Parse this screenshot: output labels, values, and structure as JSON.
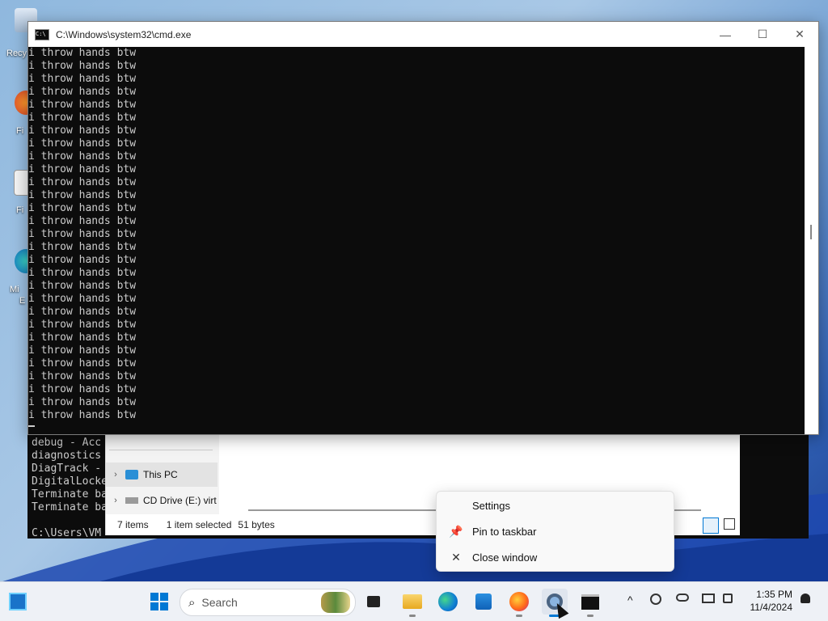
{
  "cmd_window": {
    "title": "C:\\Windows\\system32\\cmd.exe",
    "output_lines": [
      "i throw hands btw",
      "i throw hands btw",
      "i throw hands btw",
      "i throw hands btw",
      "i throw hands btw",
      "i throw hands btw",
      "i throw hands btw",
      "i throw hands btw",
      "i throw hands btw",
      "i throw hands btw",
      "i throw hands btw",
      "i throw hands btw",
      "i throw hands btw",
      "i throw hands btw",
      "i throw hands btw",
      "i throw hands btw",
      "i throw hands btw",
      "i throw hands btw",
      "i throw hands btw",
      "i throw hands btw",
      "i throw hands btw",
      "i throw hands btw",
      "i throw hands btw",
      "i throw hands btw",
      "i throw hands btw",
      "i throw hands btw",
      "i throw hands btw",
      "i throw hands btw",
      "i throw hands btw"
    ],
    "icon_label": "C:\\",
    "minimize_icon": "—",
    "maximize_icon": "☐",
    "close_icon": "✕"
  },
  "background_console": {
    "lines": [
      "debug - Acc",
      "diagnostics",
      "DiagTrack -",
      "DigitalLocke",
      "Terminate ba",
      "Terminate ba",
      "",
      "C:\\Users\\VM"
    ]
  },
  "explorer": {
    "nav": [
      {
        "label": "This PC",
        "icon": "computer-icon",
        "chevron": "›"
      },
      {
        "label": "CD Drive (E:) virt",
        "icon": "cd-drive-icon",
        "chevron": "›"
      }
    ],
    "status": {
      "items": "7 items",
      "selected": "1 item selected",
      "size": "51 bytes"
    }
  },
  "desktop_icons": [
    {
      "label": "Recy",
      "icon": "recycle-bin-icon"
    },
    {
      "label": "Fi",
      "icon": "firefox-shortcut-icon"
    },
    {
      "label": "Fi",
      "icon": "file-shortcut-icon"
    },
    {
      "label": "Mi",
      "icon": "edge-shortcut-icon"
    },
    {
      "label": "E",
      "icon": "edge-shortcut-label"
    }
  ],
  "context_menu": {
    "items": [
      {
        "label": "Settings",
        "icon": ""
      },
      {
        "label": "Pin to taskbar",
        "icon": "📌"
      },
      {
        "label": "Close window",
        "icon": "✕"
      }
    ]
  },
  "taskbar": {
    "search_label": "Search",
    "search_icon": "⌕",
    "tray_up": "^",
    "clock_time": "1:35 PM",
    "clock_date": "11/4/2024",
    "accent": "#0078d4"
  }
}
